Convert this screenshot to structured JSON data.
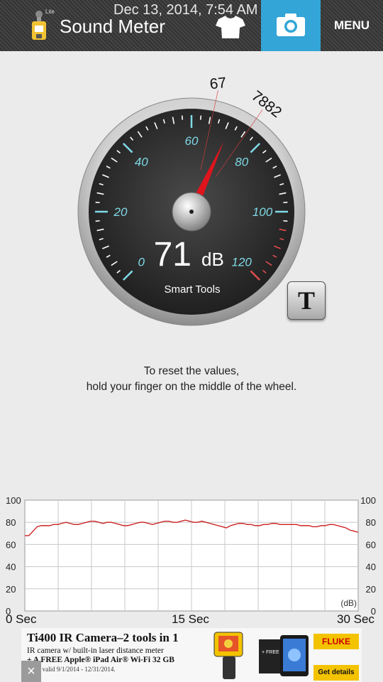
{
  "header": {
    "lite_badge": "Lite",
    "title": "Sound Meter",
    "datetime": "Dec 13, 2014, 7:54 AM",
    "menu_label": "MENU"
  },
  "gauge": {
    "scale_min": 0,
    "scale_max": 120,
    "tick_labels": [
      "0",
      "20",
      "40",
      "60",
      "80",
      "100",
      "120"
    ],
    "current_value": "71",
    "unit": "dB",
    "brand": "Smart Tools",
    "needle_value": 71,
    "min_marker": "67",
    "max_marker": "7882",
    "colors": {
      "ticks": "#7fd9e6",
      "needle": "#e0141c",
      "face": "#2b2b2b"
    }
  },
  "t_button_label": "T",
  "hint": {
    "line1": "To reset the values,",
    "line2": "hold your finger on the middle of the wheel."
  },
  "graph": {
    "y_ticks": [
      "100",
      "80",
      "60",
      "40",
      "20",
      "0"
    ],
    "unit_label": "(dB)",
    "x_labels": [
      "0 Sec",
      "15 Sec",
      "30 Sec"
    ],
    "y_range": [
      0,
      100
    ],
    "line_color": "#cc2222",
    "series": [
      68,
      68,
      72,
      76,
      77,
      77,
      77,
      78,
      78,
      79,
      80,
      79,
      78,
      78,
      79,
      80,
      81,
      81,
      80,
      79,
      80,
      80,
      79,
      78,
      77,
      77,
      78,
      79,
      80,
      80,
      79,
      78,
      79,
      80,
      81,
      81,
      80,
      80,
      81,
      82,
      81,
      80,
      80,
      81,
      80,
      79,
      78,
      77,
      76,
      75,
      77,
      78,
      79,
      79,
      78,
      78,
      77,
      77,
      78,
      78,
      79,
      79,
      78,
      78,
      78,
      78,
      78,
      77,
      77,
      77,
      76,
      76,
      77,
      77,
      78,
      78,
      77,
      76,
      75,
      73,
      72,
      71
    ]
  },
  "ad": {
    "headline": "Ti400 IR Camera–2 tools in 1",
    "line2": "IR camera w/ built-in laser distance meter",
    "line3": "+ A FREE Apple® iPad Air® Wi-Fi 32 GB",
    "line4": "Offer valid 9/1/2014 - 12/31/2014.",
    "brand": "FLUKE",
    "cta": "Get details",
    "close_glyph": "×"
  }
}
